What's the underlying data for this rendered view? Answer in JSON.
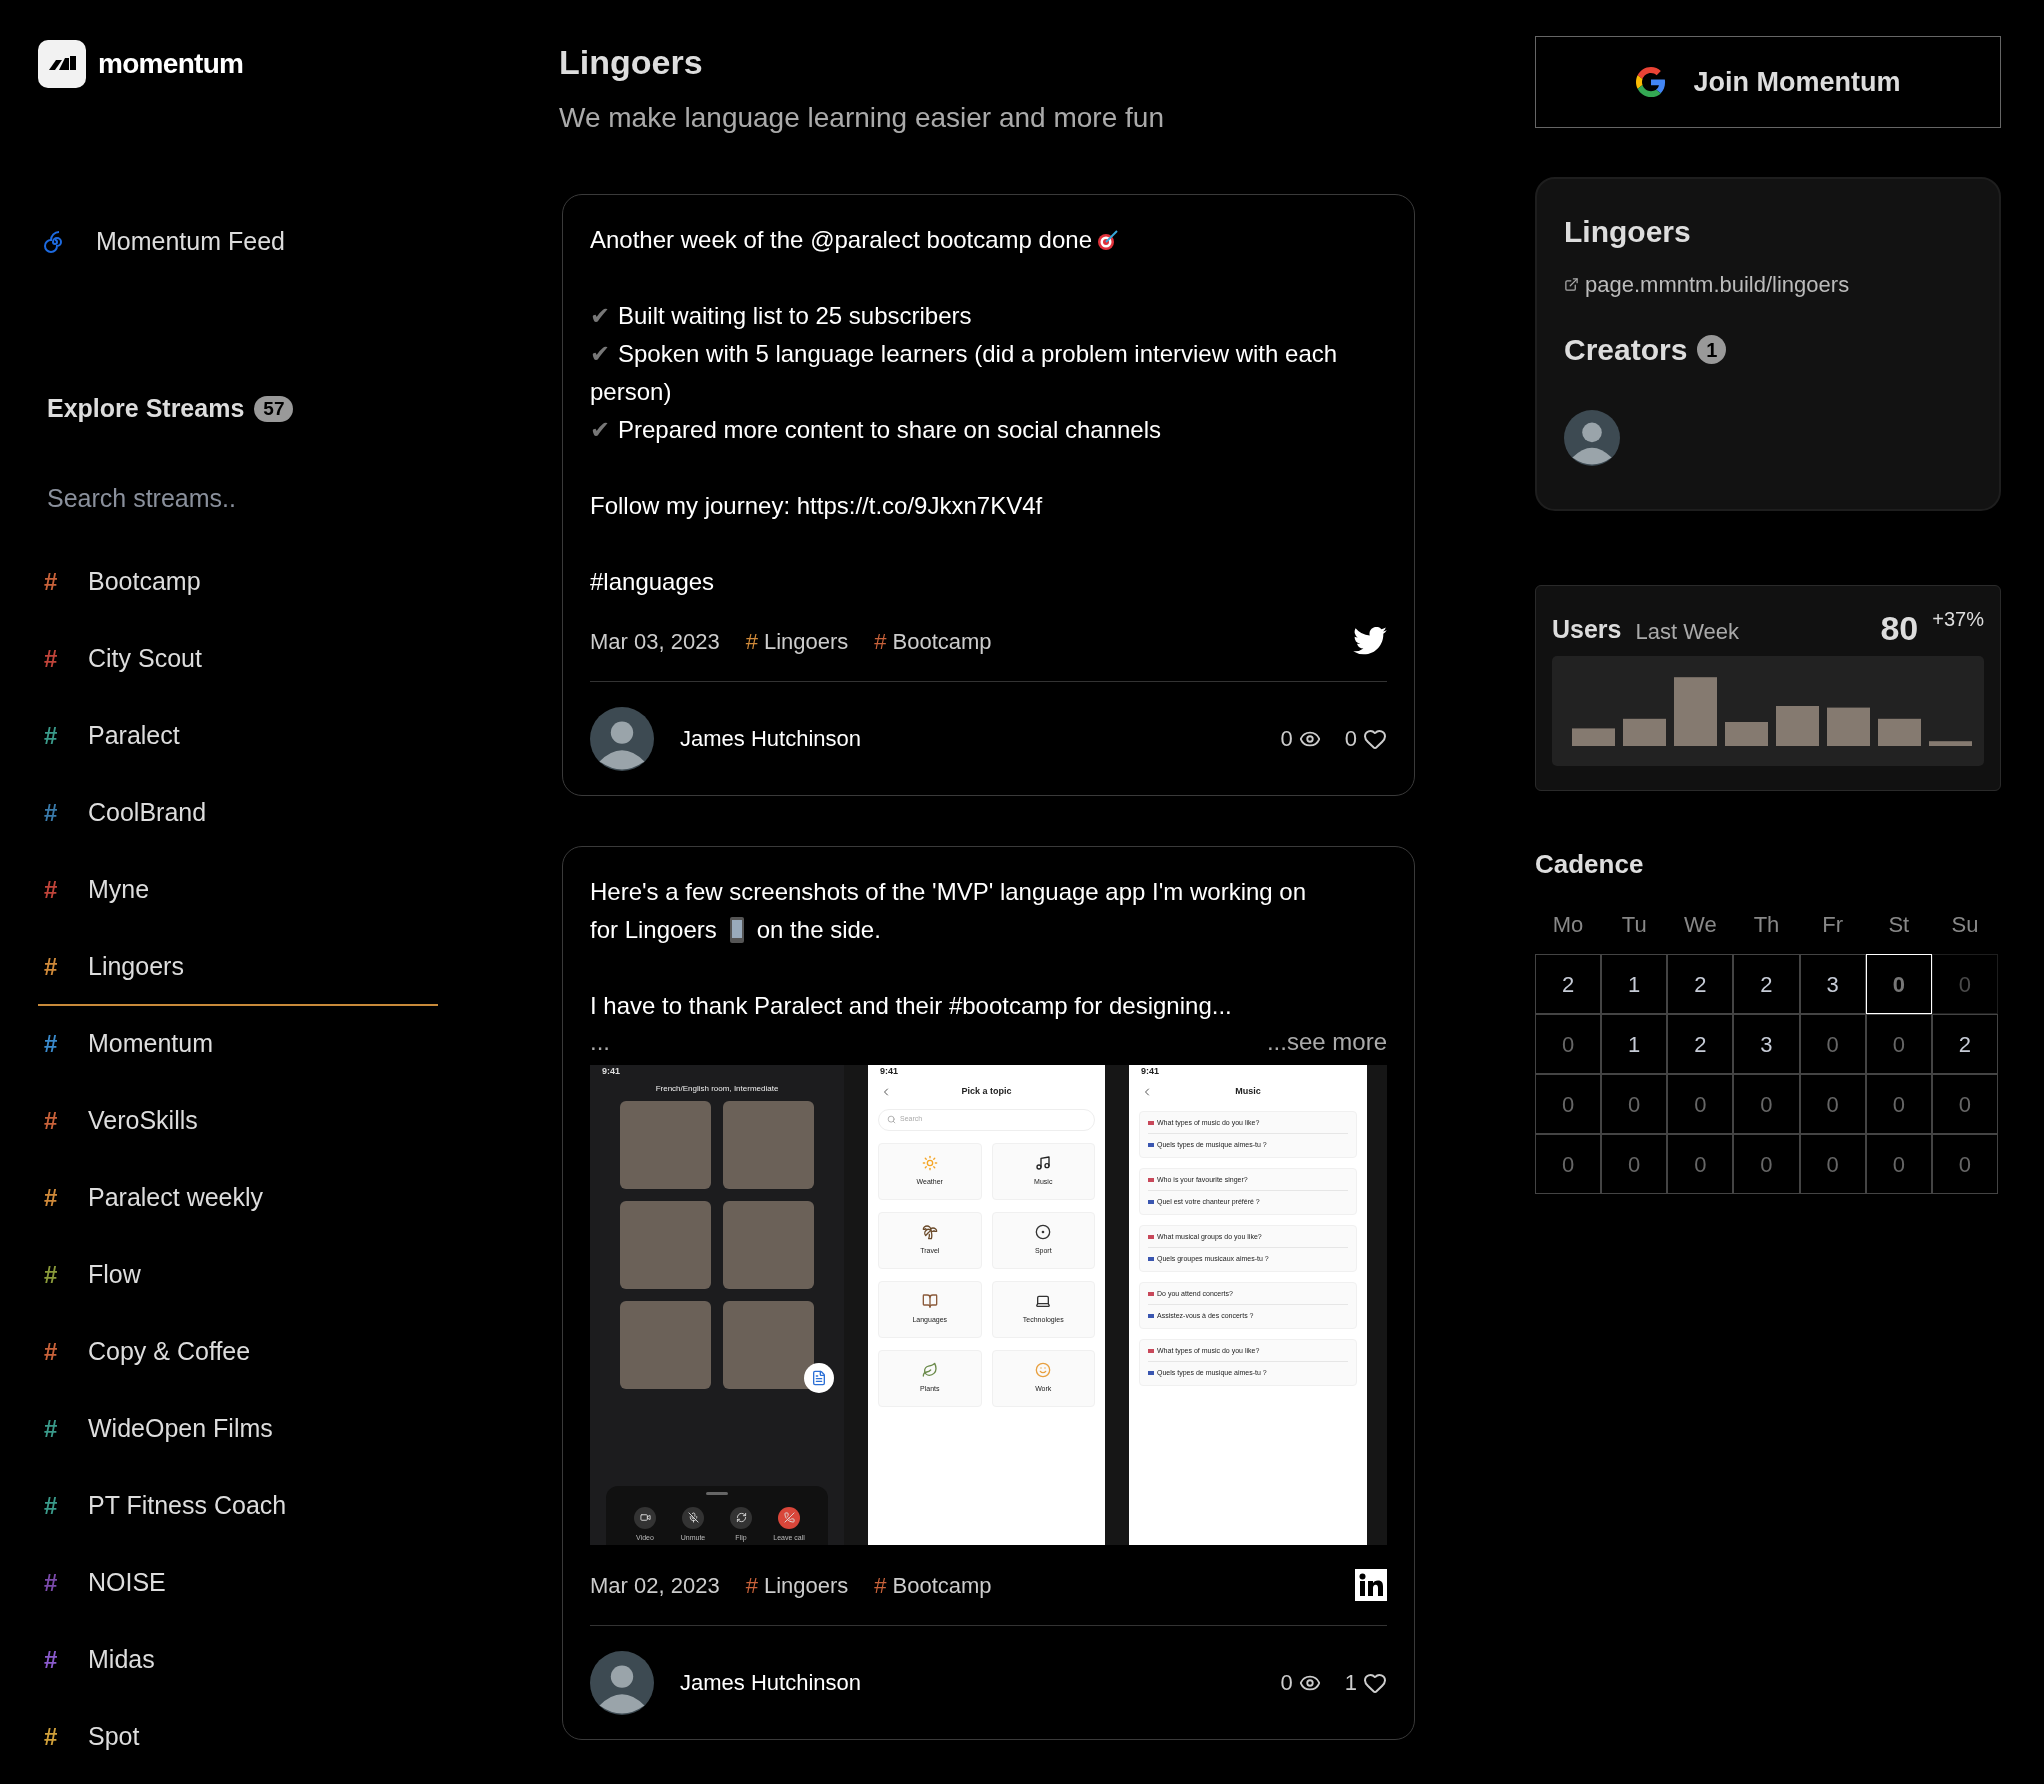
{
  "brand": {
    "name": "momentum"
  },
  "sidebar": {
    "feed": "Momentum Feed",
    "explore": {
      "title": "Explore Streams",
      "count": "57"
    },
    "search": {
      "placeholder": "Search streams.."
    },
    "streams": [
      {
        "hash": "#",
        "label": "Bootcamp",
        "color": "#c8623a",
        "selected": false
      },
      {
        "hash": "#",
        "label": "City Scout",
        "color": "#c0443a",
        "selected": false
      },
      {
        "hash": "#",
        "label": "Paralect",
        "color": "#3a9a8a",
        "selected": false
      },
      {
        "hash": "#",
        "label": "CoolBrand",
        "color": "#3a7aaa",
        "selected": false
      },
      {
        "hash": "#",
        "label": "Myne",
        "color": "#c0443a",
        "selected": false
      },
      {
        "hash": "#",
        "label": "Lingoers",
        "color": "#d08a3a",
        "selected": true
      },
      {
        "hash": "#",
        "label": "Momentum",
        "color": "#3a8acc",
        "selected": false
      },
      {
        "hash": "#",
        "label": "VeroSkills",
        "color": "#c8623a",
        "selected": false
      },
      {
        "hash": "#",
        "label": "Paralect weekly",
        "color": "#d08a3a",
        "selected": false
      },
      {
        "hash": "#",
        "label": "Flow",
        "color": "#8a9a3a",
        "selected": false
      },
      {
        "hash": "#",
        "label": "Copy & Coffee",
        "color": "#c8623a",
        "selected": false
      },
      {
        "hash": "#",
        "label": "WideOpen Films",
        "color": "#3a9a8a",
        "selected": false
      },
      {
        "hash": "#",
        "label": "PT Fitness Coach",
        "color": "#3a9a8a",
        "selected": false
      },
      {
        "hash": "#",
        "label": "NOISE",
        "color": "#7a4aaa",
        "selected": false
      },
      {
        "hash": "#",
        "label": "Midas",
        "color": "#8a5acc",
        "selected": false
      },
      {
        "hash": "#",
        "label": "Spot",
        "color": "#d0a03a",
        "selected": false
      }
    ]
  },
  "header": {
    "title": "Lingoers",
    "subtitle": "We make language learning easier and more fun"
  },
  "posts": [
    {
      "kind": "tweet",
      "blocks": [
        {
          "kind": "icon_line",
          "text": "Another week of the @paralect bootcamp done"
        },
        {
          "kind": "blank"
        },
        {
          "kind": "check",
          "mark": "✔",
          "text": "Built waiting list to 25 subscribers"
        },
        {
          "kind": "check",
          "mark": "✔",
          "text": "Spoken with 5 language learners (did a problem interview with each person)"
        },
        {
          "kind": "check",
          "mark": "✔",
          "text": "Prepared more content to share on social channels"
        },
        {
          "kind": "blank"
        },
        {
          "kind": "line",
          "text": "Follow my journey: https://t.co/9Jkxn7KV4f"
        },
        {
          "kind": "blank"
        },
        {
          "kind": "line",
          "text": "#languages"
        }
      ],
      "date": "Mar 03, 2023",
      "tags": [
        {
          "hash": "#",
          "label": "Lingoers",
          "color": "#d08a3a"
        },
        {
          "hash": "#",
          "label": "Bootcamp",
          "color": "#c8623a"
        }
      ],
      "author": "James Hutchinson",
      "views": "0",
      "likes": "0"
    },
    {
      "kind": "linkedin",
      "blocks": [
        {
          "kind": "line",
          "text": "Here's a few screenshots of the 'MVP' language app I'm working on"
        },
        {
          "kind": "icon_line",
          "text": "for Lingoers",
          "text_after": "on the side."
        },
        {
          "kind": "blank"
        },
        {
          "kind": "line",
          "text": "I have to thank Paralect and their #bootcamp for designing..."
        },
        {
          "kind": "more",
          "ellipsis": "...",
          "link": "...see more"
        }
      ],
      "attachment": {
        "panels": [
          {
            "kind": "call",
            "time": "9:41",
            "room": "French/English room, Intermediate",
            "controls": [
              {
                "label": "Video",
                "danger": false
              },
              {
                "label": "Unmute",
                "danger": false
              },
              {
                "label": "Flip",
                "danger": false
              },
              {
                "label": "Leave call",
                "danger": true
              }
            ]
          },
          {
            "kind": "topics",
            "time": "9:41",
            "title": "Pick a topic",
            "search": {
              "placeholder": "Search"
            },
            "topics": [
              "Weather",
              "Music",
              "Travel",
              "Sport",
              "Languages",
              "Technologies",
              "Plants",
              "Work"
            ]
          },
          {
            "kind": "questions",
            "time": "9:41",
            "title": "Music",
            "questions": [
              {
                "en": "What types of music do you like?",
                "fr": "Quels types de musique aimes-tu ?"
              },
              {
                "en": "Who is your favourite singer?",
                "fr": "Quel est votre chanteur préféré ?"
              },
              {
                "en": "What musical groups do you like?",
                "fr": "Quels groupes musicaux aimes-tu ?"
              },
              {
                "en": "Do you attend concerts?",
                "fr": "Assistez-vous à des concerts ?"
              },
              {
                "en": "What types of music do you like?",
                "fr": "Quels types de musique aimes-tu ?"
              }
            ]
          }
        ]
      },
      "date": "Mar 02, 2023",
      "tags": [
        {
          "hash": "#",
          "label": "Lingoers",
          "color": "#c8623a"
        },
        {
          "hash": "#",
          "label": "Bootcamp",
          "color": "#c8623a"
        }
      ],
      "author": "James Hutchinson",
      "views": "0",
      "likes": "1"
    }
  ],
  "join_button": {
    "label": "Join Momentum"
  },
  "stream_card": {
    "title": "Lingoers",
    "link": "page.mmntm.build/lingoers",
    "creators": {
      "label": "Creators",
      "count": "1"
    }
  },
  "users_card": {
    "title": "Users",
    "period": "Last Week",
    "value": "80",
    "change": "+37%"
  },
  "cadence": {
    "title": "Cadence",
    "days": [
      "Mo",
      "Tu",
      "We",
      "Th",
      "Fr",
      "St",
      "Su"
    ],
    "rows": [
      [
        {
          "value": "2",
          "kind": "count"
        },
        {
          "value": "1",
          "kind": "count"
        },
        {
          "value": "2",
          "kind": "count"
        },
        {
          "value": "2",
          "kind": "count"
        },
        {
          "value": "3",
          "kind": "count"
        },
        {
          "value": "0",
          "kind": "today"
        },
        {
          "value": "0",
          "kind": "future"
        }
      ],
      [
        {
          "value": "0",
          "kind": "zero"
        },
        {
          "value": "1",
          "kind": "count"
        },
        {
          "value": "2",
          "kind": "count"
        },
        {
          "value": "3",
          "kind": "count"
        },
        {
          "value": "0",
          "kind": "zero"
        },
        {
          "value": "0",
          "kind": "zero"
        },
        {
          "value": "2",
          "kind": "count"
        }
      ],
      [
        {
          "value": "0",
          "kind": "zero"
        },
        {
          "value": "0",
          "kind": "zero"
        },
        {
          "value": "0",
          "kind": "zero"
        },
        {
          "value": "0",
          "kind": "zero"
        },
        {
          "value": "0",
          "kind": "zero"
        },
        {
          "value": "0",
          "kind": "zero"
        },
        {
          "value": "0",
          "kind": "zero"
        }
      ],
      [
        {
          "value": "0",
          "kind": "zero"
        },
        {
          "value": "0",
          "kind": "zero"
        },
        {
          "value": "0",
          "kind": "zero"
        },
        {
          "value": "0",
          "kind": "zero"
        },
        {
          "value": "0",
          "kind": "zero"
        },
        {
          "value": "0",
          "kind": "zero"
        },
        {
          "value": "0",
          "kind": "zero"
        }
      ]
    ]
  }
}
